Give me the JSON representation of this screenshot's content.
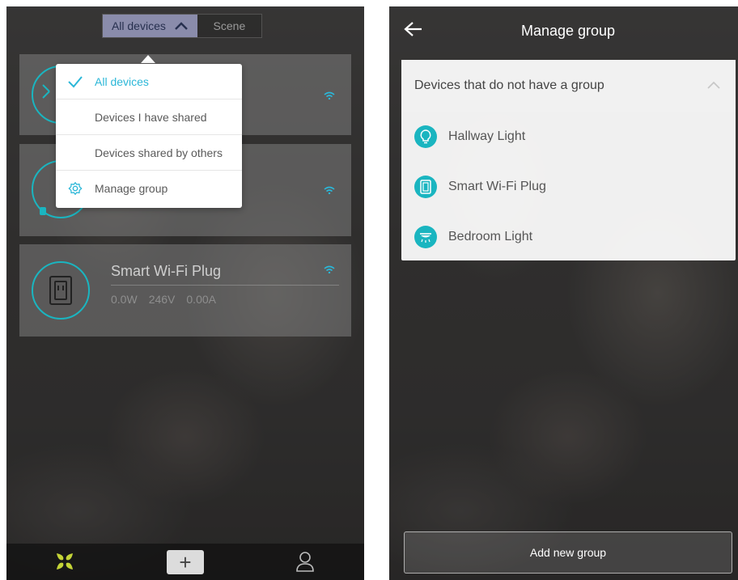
{
  "left": {
    "segment": {
      "active_label": "All devices",
      "inactive_label": "Scene"
    },
    "devices": [
      {
        "name": "",
        "icon": "lamp-icon"
      },
      {
        "name": "",
        "icon": "bulb-icon"
      },
      {
        "name": "Smart Wi-Fi Plug",
        "icon": "plug-icon",
        "power": "0.0W",
        "voltage": "246V",
        "current": "0.00A"
      }
    ],
    "menu": {
      "items": [
        {
          "label": "All devices",
          "selected": true,
          "icon": "check-icon"
        },
        {
          "label": "Devices I have shared",
          "selected": false
        },
        {
          "label": "Devices shared by others",
          "selected": false
        },
        {
          "label": "Manage group",
          "selected": false,
          "icon": "gear-icon"
        }
      ]
    },
    "nav": {
      "home_icon": "home-grid-icon",
      "add_label": "+",
      "user_icon": "user-icon"
    }
  },
  "right": {
    "header": {
      "title": "Manage group",
      "back_icon": "back-arrow-icon"
    },
    "panel": {
      "title": "Devices that do not have a group",
      "items": [
        {
          "label": "Hallway Light",
          "icon": "bulb-icon"
        },
        {
          "label": "Smart Wi-Fi Plug",
          "icon": "plug-icon"
        },
        {
          "label": "Bedroom Light",
          "icon": "ceiling-light-icon"
        }
      ]
    },
    "add_button": "Add new group"
  },
  "colors": {
    "accent": "#1ab5c0",
    "selected_text": "#2bb7d8",
    "segment_active": "#8a8cab"
  }
}
